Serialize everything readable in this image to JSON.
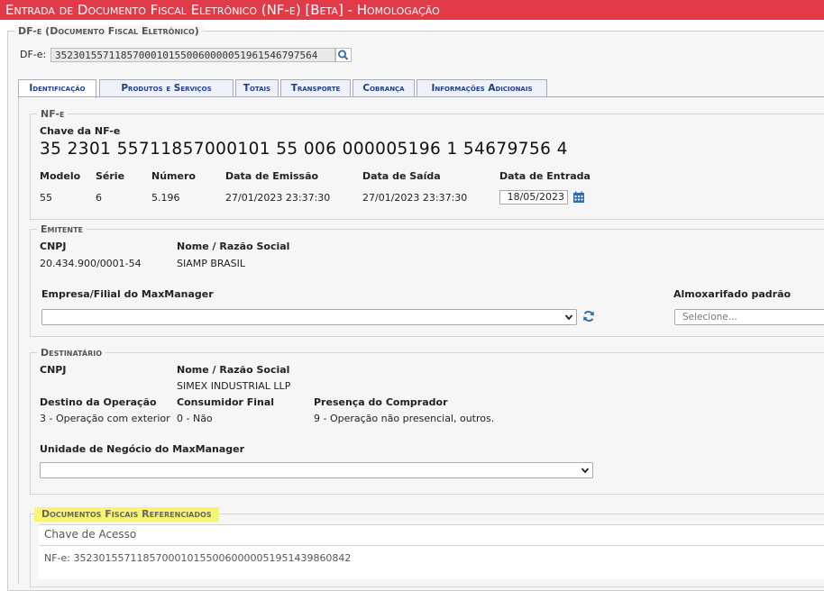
{
  "title": "Entrada de Documento Fiscal Eletrônico (NF-e) [Beta]  - Homologação",
  "dfe_section": {
    "legend": "DF-e (Documento Fiscal Eletrônico)",
    "label": "DF-e:",
    "value": "35230155711857000101550060000051961546797564",
    "search_icon": "search-icon"
  },
  "tabs": [
    {
      "label": "Identificação",
      "active": true
    },
    {
      "label": "Produtos e Serviços",
      "active": false
    },
    {
      "label": "Totais",
      "active": false
    },
    {
      "label": "Transporte",
      "active": false
    },
    {
      "label": "Cobrança",
      "active": false
    },
    {
      "label": "Informações Adicionais",
      "active": false
    }
  ],
  "nfe": {
    "legend": "NF-e",
    "chave_label": "Chave da NF-e",
    "chave_value": "35 2301 55711857000101 55 006 000005196 1 54679756 4",
    "columns": {
      "modelo": {
        "label": "Modelo",
        "value": "55"
      },
      "serie": {
        "label": "Série",
        "value": "6"
      },
      "numero": {
        "label": "Número",
        "value": "5.196"
      },
      "data_emissao": {
        "label": "Data de Emissão",
        "value": "27/01/2023 23:37:30"
      },
      "data_saida": {
        "label": "Data de Saída",
        "value": "27/01/2023 23:37:30"
      },
      "data_entrada": {
        "label": "Data de Entrada",
        "value": "18/05/2023"
      }
    }
  },
  "emitente": {
    "legend": "Emitente",
    "cnpj_label": "CNPJ",
    "cnpj_value": "20.434.900/0001-54",
    "nome_label": "Nome / Razão Social",
    "nome_value": "SIAMP BRASIL",
    "empresa_label": "Empresa/Filial do MaxManager",
    "empresa_value": "",
    "almox_label": "Almoxarifado padrão",
    "almox_placeholder": "Selecione..."
  },
  "destinatario": {
    "legend": "Destinatário",
    "cnpj_label": "CNPJ",
    "cnpj_value": "",
    "nome_label": "Nome / Razão Social",
    "nome_value": "SIMEX INDUSTRIAL LLP",
    "destino_label": "Destino da Operação",
    "destino_value": "3 - Operação com exterior",
    "consumidor_label": "Consumidor Final",
    "consumidor_value": "0 - Não",
    "presenca_label": "Presença do Comprador",
    "presenca_value": "9 - Operação não presencial, outros.",
    "unidade_label": "Unidade de Negócio do MaxManager",
    "unidade_value": ""
  },
  "docs_ref": {
    "legend": "Documentos Fiscais Referenciados",
    "column": "Chave de Acesso",
    "rows": [
      "NF-e: 35230155711857000101550060000051951439860842"
    ]
  },
  "colors": {
    "title_bar": "#e13b4a",
    "tab_text": "#1f3f8a",
    "highlight": "#f8f570",
    "icon_blue": "#2a6fb5"
  }
}
